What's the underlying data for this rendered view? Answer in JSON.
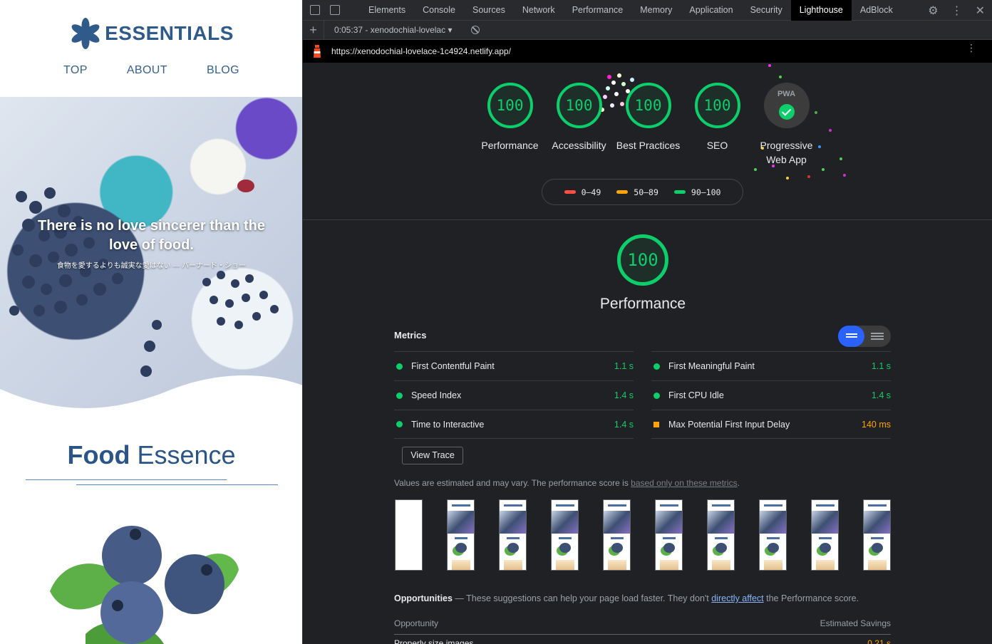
{
  "site": {
    "logo_text": "ESSENTIALS",
    "nav": [
      "TOP",
      "ABOUT",
      "BLOG"
    ],
    "hero_quote": "There is no love sincerer than the love of food.",
    "hero_sub": "食物を愛するよりも誠実な愛はない — バーナード・ショー",
    "section_title_bold": "Food",
    "section_title_rest": " Essence"
  },
  "devtools": {
    "tabs": [
      "Elements",
      "Console",
      "Sources",
      "Network",
      "Performance",
      "Memory",
      "Application",
      "Security",
      "Lighthouse",
      "AdBlock"
    ],
    "active_tab": "Lighthouse",
    "run_label": "0:05:37 - xenodochial-lovelac",
    "url": "https://xenodochial-lovelace-1c4924.netlify.app/"
  },
  "report": {
    "categories": [
      {
        "score": "100",
        "label": "Performance"
      },
      {
        "score": "100",
        "label": "Accessibility"
      },
      {
        "score": "100",
        "label": "Best Practices"
      },
      {
        "score": "100",
        "label": "SEO"
      }
    ],
    "pwa": {
      "badge": "PWA",
      "label": "Progressive Web App"
    },
    "legend": [
      {
        "range": "0–49",
        "color": "#ff4e42"
      },
      {
        "range": "50–89",
        "color": "#ffa400"
      },
      {
        "range": "90–100",
        "color": "#0cce6b"
      }
    ],
    "performance_score": "100",
    "performance_title": "Performance",
    "metrics_heading": "Metrics",
    "metrics": [
      {
        "name": "First Contentful Paint",
        "value": "1.1 s",
        "status": "pass"
      },
      {
        "name": "First Meaningful Paint",
        "value": "1.1 s",
        "status": "pass"
      },
      {
        "name": "Speed Index",
        "value": "1.4 s",
        "status": "pass"
      },
      {
        "name": "First CPU Idle",
        "value": "1.4 s",
        "status": "pass"
      },
      {
        "name": "Time to Interactive",
        "value": "1.4 s",
        "status": "pass"
      },
      {
        "name": "Max Potential First Input Delay",
        "value": "140 ms",
        "status": "average"
      }
    ],
    "view_trace": "View Trace",
    "est_note": "Values are estimated and may vary. The performance score is ",
    "est_link": "based only on these metrics",
    "opps_title": "Opportunities",
    "opps_text1": " — These suggestions can help your page load faster. They don't ",
    "opps_link": "directly affect",
    "opps_text2": " the Performance score.",
    "opp_col1": "Opportunity",
    "opp_col2": "Estimated Savings",
    "opp_row_name": "Properly size images",
    "opp_row_val": "0.21 s"
  },
  "colors": {
    "pass": "#0cce6b",
    "average": "#ffa400",
    "fail": "#ff4e42",
    "brand": "#2f5a8a"
  }
}
